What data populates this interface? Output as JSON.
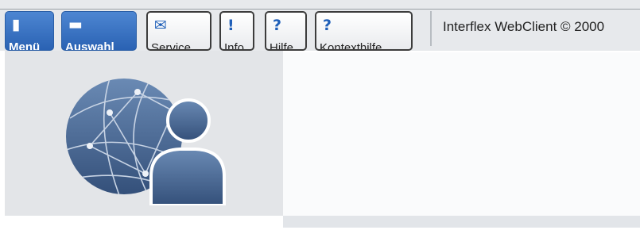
{
  "toolbar": {
    "buttons": [
      {
        "id": "menu",
        "label": "Menü",
        "icon": "menu-bar-icon",
        "glyph": "▮",
        "style": "primary"
      },
      {
        "id": "auswahl",
        "label": "Auswahl",
        "icon": "selection-dash-icon",
        "glyph": "▬",
        "style": "primary"
      },
      {
        "id": "service",
        "label": "Service",
        "icon": "envelope-icon",
        "glyph": "✉",
        "style": "secondary"
      },
      {
        "id": "info",
        "label": "Info",
        "icon": "exclamation-icon",
        "glyph": "!",
        "style": "secondary"
      },
      {
        "id": "hilfe",
        "label": "Hilfe",
        "icon": "question-icon",
        "glyph": "?",
        "style": "secondary"
      },
      {
        "id": "kontexthilfe",
        "label": "Kontexthilfe",
        "icon": "question-icon",
        "glyph": "?",
        "style": "secondary"
      }
    ],
    "copyright": "Interflex WebClient © 2000"
  },
  "logo": {
    "icon": "globe-user-icon"
  },
  "colors": {
    "accent": "#2a62b3",
    "logo": "#4a6891",
    "panel": "#e3e5e8"
  }
}
